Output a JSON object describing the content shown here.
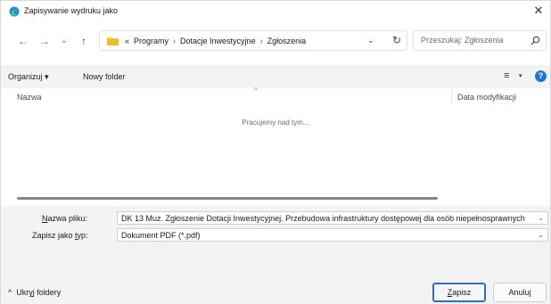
{
  "window": {
    "title": "Zapisywanie wydruku jako",
    "close_glyph": "✕"
  },
  "nav": {
    "back_glyph": "←",
    "forward_glyph": "→",
    "recent_glyph": "⌄",
    "up_glyph": "↑",
    "breadcrumb_prefix": "«",
    "breadcrumbs": [
      "Programy",
      "Dotacje Inwestycyjne",
      "Zgłoszenia"
    ],
    "crumb_separator": "›",
    "dropdown_glyph": "⌄",
    "refresh_glyph": "↻",
    "search_placeholder": "Przeszukaj: Zgłoszenia"
  },
  "toolbar": {
    "organize_label": "Organizuj ▾",
    "new_folder_label": "Nowy folder",
    "view_glyph": "≡",
    "view_dropdown_glyph": "▾",
    "help_glyph": "?"
  },
  "file_list": {
    "columns": [
      "Nazwa",
      "Data modyfikacji"
    ],
    "sort_indicator": "^",
    "status_text": "Pracujemy nad tym..."
  },
  "form": {
    "filename_label_prefix": "",
    "filename_label_key": "N",
    "filename_label_rest": "azwa pliku:",
    "filename_value": "DK 13 Muz. Zgłoszenie Dotacji Inwestycyjnej. Przebudowa infrastruktury dostępowej dla osób niepełnosprawnych",
    "type_label_prefix": "Zapisz jako ",
    "type_label_key": "t",
    "type_label_rest": "yp:",
    "type_value": "Dokument PDF (*.pdf)",
    "dropdown_glyph": "⌄"
  },
  "footer": {
    "hide_folders_glyph": "^",
    "hide_folders_prefix": "Ukr",
    "hide_folders_key": "y",
    "hide_folders_rest": "j foldery",
    "save_key": "Z",
    "save_rest": "apisz",
    "cancel_label": "Anuluj"
  },
  "colors": {
    "accent": "#1f75d6",
    "folder": "#f6c94e",
    "panel": "#f3f3f3",
    "save_border": "#2f6fbf"
  }
}
